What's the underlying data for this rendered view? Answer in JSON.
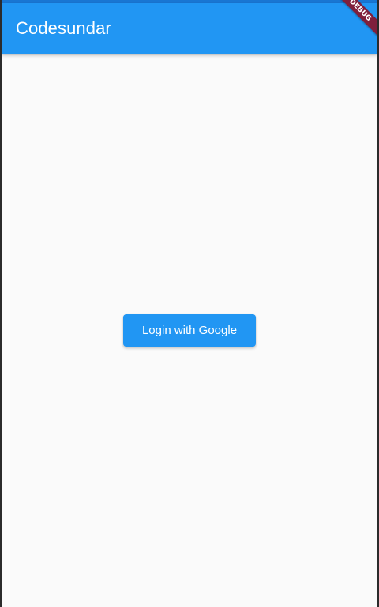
{
  "app_bar": {
    "title": "Codesundar",
    "color": "#2196f3"
  },
  "debug_banner": {
    "label": "DEBUG"
  },
  "main": {
    "login_button_label": "Login with Google"
  },
  "colors": {
    "primary": "#2196f3",
    "background": "#fafafa",
    "debug_banner": "#7f1f3c"
  }
}
